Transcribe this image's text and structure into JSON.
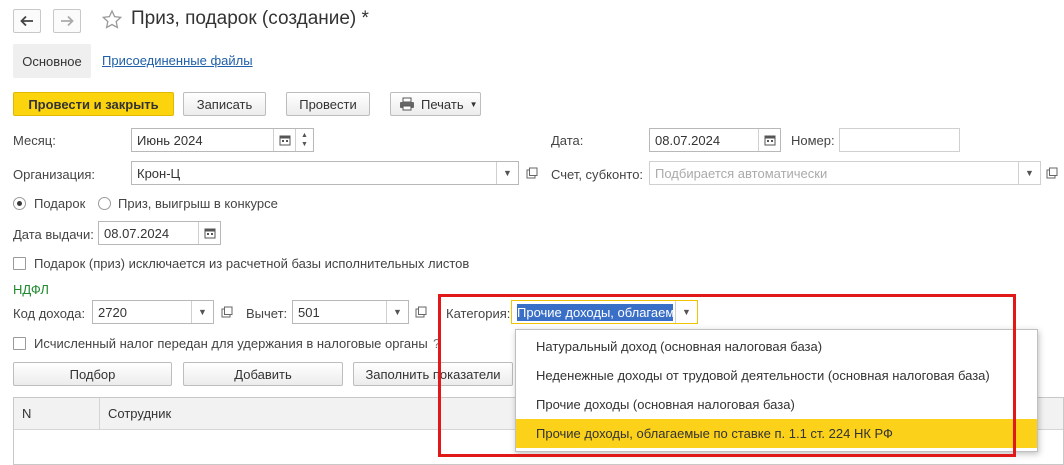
{
  "header": {
    "title": "Приз, подарок (создание) *"
  },
  "tabs": {
    "main": "Основное",
    "files": "Присоединенные файлы"
  },
  "toolbar": {
    "post_close": "Провести и закрыть",
    "save": "Записать",
    "post": "Провести",
    "print": "Печать"
  },
  "form": {
    "month_label": "Месяц:",
    "month_value": "Июнь 2024",
    "date_label": "Дата:",
    "date_value": "08.07.2024",
    "number_label": "Номер:",
    "number_value": "",
    "org_label": "Организация:",
    "org_value": "Крон-Ц",
    "account_label": "Счет, субконто:",
    "account_placeholder": "Подбирается автоматически",
    "radio_gift": "Подарок",
    "radio_prize": "Приз, выигрыш в конкурсе",
    "issue_date_label": "Дата выдачи:",
    "issue_date_value": "08.07.2024",
    "exclude_checkbox": "Подарок (приз) исключается из расчетной базы исполнительных листов",
    "ndfl_section": "НДФЛ",
    "income_code_label": "Код дохода:",
    "income_code_value": "2720",
    "deduction_label": "Вычет:",
    "deduction_value": "501",
    "category_label": "Категория:",
    "category_value": "Прочие доходы, облагаем",
    "tax_transferred_checkbox": "Исчисленный налог передан для удержания в налоговые органы",
    "help_mark": "?"
  },
  "table_buttons": {
    "select": "Подбор",
    "add": "Добавить",
    "fill": "Заполнить показатели"
  },
  "table": {
    "columns": [
      "N",
      "Сотрудник"
    ]
  },
  "dropdown": {
    "items": [
      "Натуральный доход (основная налоговая база)",
      "Неденежные доходы от трудовой деятельности (основная налоговая база)",
      "Прочие доходы (основная налоговая база)",
      "Прочие доходы, облагаемые по ставке п. 1.1 ст. 224 НК РФ"
    ],
    "selected_index": 3
  },
  "colors": {
    "primary_button": "#fcd40d",
    "section_green": "#1e8a2e",
    "link_blue": "#2060a8",
    "highlight_red": "#e01818",
    "selection_blue": "#3a6fc7"
  }
}
